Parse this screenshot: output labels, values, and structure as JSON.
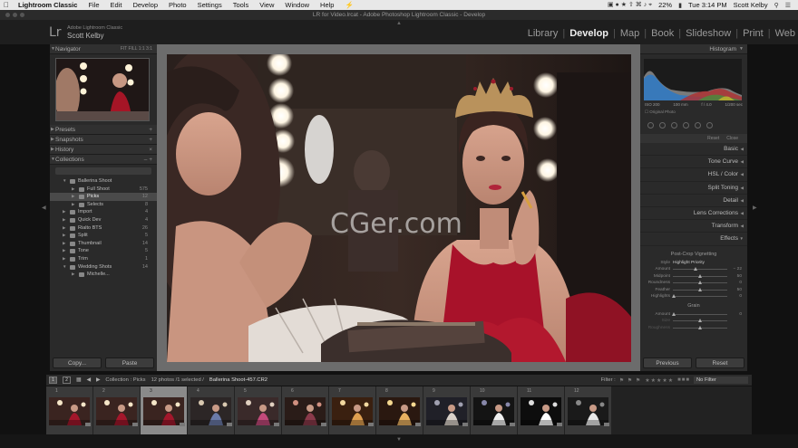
{
  "menubar": {
    "apple": "",
    "items": [
      "Lightroom Classic",
      "File",
      "Edit",
      "Develop",
      "Photo",
      "Settings",
      "Tools",
      "View",
      "Window",
      "Help"
    ],
    "battery": "22%",
    "clock": "Tue 3:14 PM",
    "user": "Scott Kelby"
  },
  "window": {
    "title": "LR for Video.lrcat - Adobe Photoshop Lightroom Classic - Develop"
  },
  "identity": {
    "logo": "Lr",
    "product": "Adobe Lightroom Classic",
    "user": "Scott Kelby",
    "modules": [
      "Library",
      "Develop",
      "Map",
      "Book",
      "Slideshow",
      "Print",
      "Web"
    ],
    "active_module": "Develop"
  },
  "left": {
    "navigator": {
      "label": "Navigator",
      "zoom": "FIT  FILL  1:1  3:1"
    },
    "sections": [
      {
        "label": "Presets"
      },
      {
        "label": "Snapshots"
      },
      {
        "label": "History"
      },
      {
        "label": "Collections"
      }
    ],
    "collections": [
      {
        "label": "Ballerina Shoot",
        "count": "",
        "level": 1,
        "expanded": true
      },
      {
        "label": "Full Shoot",
        "count": "575",
        "level": 2
      },
      {
        "label": "Picks",
        "count": "12",
        "level": 2,
        "selected": true
      },
      {
        "label": "Selects",
        "count": "8",
        "level": 2
      },
      {
        "label": "Import",
        "count": "4",
        "level": 1
      },
      {
        "label": "Quick Dev",
        "count": "4",
        "level": 1
      },
      {
        "label": "Rialto BTS",
        "count": "26",
        "level": 1
      },
      {
        "label": "Split",
        "count": "5",
        "level": 1
      },
      {
        "label": "Thumbnail",
        "count": "14",
        "level": 1
      },
      {
        "label": "Tone",
        "count": "5",
        "level": 1
      },
      {
        "label": "Trim",
        "count": "1",
        "level": 1
      },
      {
        "label": "Wedding Shots",
        "count": "14",
        "level": 1,
        "expanded": true
      },
      {
        "label": "Michelle...",
        "count": "",
        "level": 2
      }
    ],
    "copy_label": "Copy...",
    "paste_label": "Paste"
  },
  "right": {
    "histogram_label": "Histogram",
    "exif": [
      "ISO 200",
      "100 mm",
      "f / 4.0",
      "1/200 sec"
    ],
    "original_photo": "Original Photo",
    "reset": "Reset",
    "close": "Close",
    "sections": [
      "Basic",
      "Tone Curve",
      "HSL / Color",
      "Split Toning",
      "Detail",
      "Lens Corrections",
      "Transform",
      "Effects"
    ],
    "vignette_title": "Post-Crop Vignetting",
    "style_label": "Style",
    "style_value": "Highlight Priority",
    "vignette_sliders": [
      {
        "name": "Amount",
        "value": "− 22",
        "pos": 0.42
      },
      {
        "name": "Midpoint",
        "value": "50",
        "pos": 0.5
      },
      {
        "name": "Roundness",
        "value": "0",
        "pos": 0.5
      },
      {
        "name": "Feather",
        "value": "50",
        "pos": 0.5
      },
      {
        "name": "Highlights",
        "value": "0",
        "pos": 0.02
      }
    ],
    "grain_title": "Grain",
    "grain_sliders": [
      {
        "name": "Amount",
        "value": "0",
        "pos": 0.02
      },
      {
        "name": "Size",
        "value": "",
        "pos": 0.5
      },
      {
        "name": "Roughness",
        "value": "",
        "pos": 0.5
      }
    ],
    "previous_label": "Previous",
    "reset_label": "Reset"
  },
  "filmbar": {
    "screen1": "1",
    "screen2": "2",
    "source": "Collection : Picks",
    "count": "12 photos /1 selected /",
    "file": "Ballerina Shoot-457.CR2",
    "filter_label": "Filter :",
    "filter_value": "No Filter"
  },
  "filmstrip": {
    "numbers": [
      "1",
      "2",
      "3",
      "4",
      "5",
      "6",
      "7",
      "8",
      "9",
      "10",
      "11",
      "12"
    ],
    "selected_index": 2
  },
  "watermark": "CGer.com"
}
